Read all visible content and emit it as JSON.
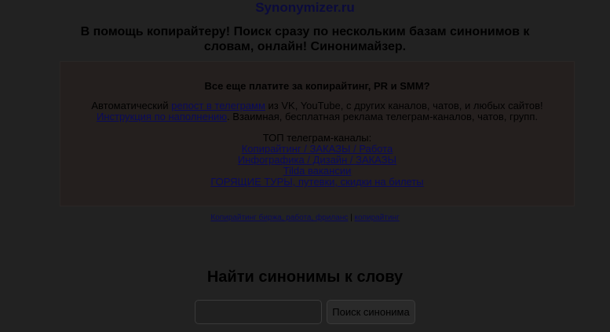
{
  "header": {
    "site_title": "Synonymizer.ru",
    "tagline": "В помощь копирайтеру! Поиск сразу по нескольким базам синонимов к словам, онлайн! Синонимайзер."
  },
  "promo": {
    "heading": "Все еще платите за копирайтинг, PR и SMM?",
    "line1_prefix": "Автоматический ",
    "line1_link": "репост в телеграмм",
    "line1_suffix": " из VK, YouTube, с других каналов, чатов, и любых сайтов!",
    "line2_link": "Инструкция по наполнению",
    "line2_suffix": ". Взаимная, бесплатная реклама телеграм-каналов, чатов, групп.",
    "top_label": "ТОП телеграм-каналы:",
    "channels": [
      "Копирайтинг / ЗАКАЗЫ / Работа",
      "Инфографика / Дизайн / ЗАКАЗЫ",
      "Tilda вакансии",
      "ГОРЯЩИЕ ТУРЫ, путевки, скидки на билеты"
    ]
  },
  "footer": {
    "link1": "Копирайтинг биржа, работа, фриланс",
    "separator": "|",
    "link2": "копирайтинг"
  },
  "search": {
    "title": "Найти синонимы к слову",
    "input_value": "",
    "input_placeholder": "",
    "button_label": "Поиск синонима"
  }
}
